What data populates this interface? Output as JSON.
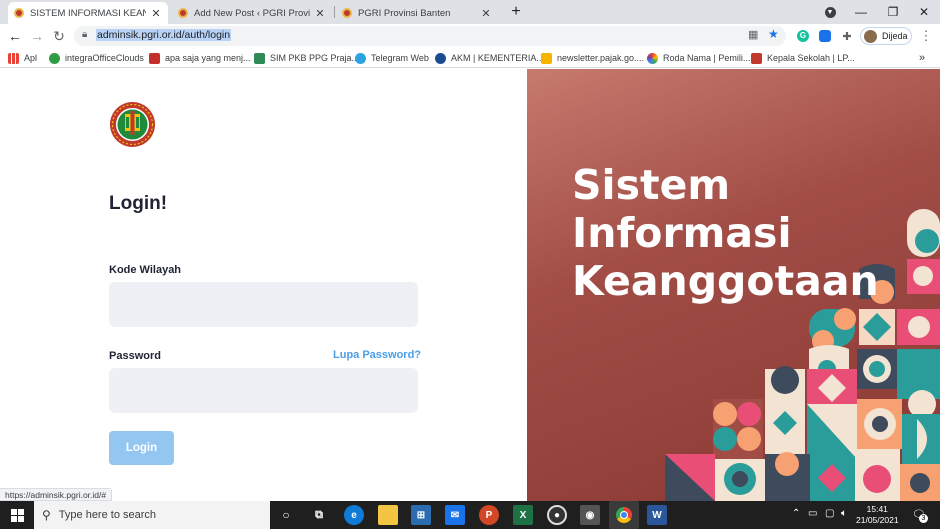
{
  "browser": {
    "tabs": [
      {
        "title": "SISTEM INFORMASI KEANGGOTA...",
        "active": true
      },
      {
        "title": "Add New Post ‹ PGRI Provinsi Ban...",
        "active": false
      },
      {
        "title": "PGRI Provinsi Banten",
        "active": false
      }
    ],
    "new_tab_icon": "plus-icon",
    "url": "adminsik.pgri.or.id/auth/login",
    "profile_name": "Dijeda",
    "bookmarks": [
      {
        "label": "Apl",
        "color": "#ea4335"
      },
      {
        "label": "integraOfficeClouds",
        "color": "#2e9e44"
      },
      {
        "label": "apa saja yang menj...",
        "color": "#c4302b"
      },
      {
        "label": "SIM PKB PPG Praja...",
        "color": "#2e8b57"
      },
      {
        "label": "Telegram Web",
        "color": "#2aa3df"
      },
      {
        "label": "AKM | KEMENTERIA...",
        "color": "#1a4d8f"
      },
      {
        "label": "newsletter.pajak.go....",
        "color": "#f4b400"
      },
      {
        "label": "Roda Nama | Pemili...",
        "color": "#7b3fa0"
      },
      {
        "label": "Kepala Sekolah | LP...",
        "color": "#c0392b"
      }
    ]
  },
  "login": {
    "heading": "Login!",
    "kode_label": "Kode Wilayah",
    "password_label": "Password",
    "forgot_label": "Lupa Password?",
    "button_label": "Login"
  },
  "hero": {
    "line1": "Sistem",
    "line2": "Informasi",
    "line3": "Keanggotaan"
  },
  "status_url": "https://adminsik.pgri.or.id/#",
  "taskbar": {
    "search_placeholder": "Type here to search",
    "time": "15:41",
    "date": "21/05/2021",
    "notification_count": "3"
  },
  "colors": {
    "accent": "#4a9ee8",
    "login_button": "#94c6f2",
    "hero_bg": "#a14d46"
  }
}
